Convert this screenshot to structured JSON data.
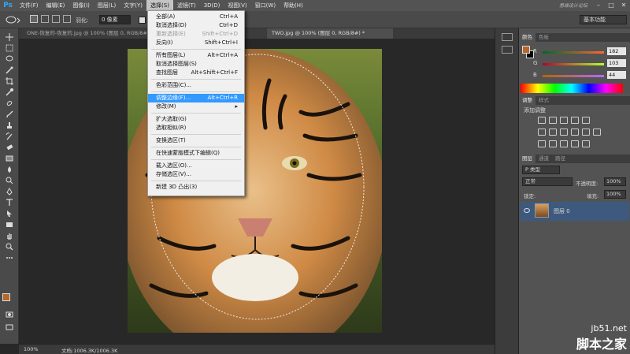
{
  "app": {
    "logo": "Ps"
  },
  "menubar": {
    "items": [
      "文件(F)",
      "编辑(E)",
      "图像(I)",
      "图层(L)",
      "文字(Y)",
      "选择(S)",
      "滤镜(T)",
      "3D(D)",
      "视图(V)",
      "窗口(W)",
      "帮助(H)"
    ],
    "active_index": 5,
    "user_text": "思缘设计论坛"
  },
  "options": {
    "feather_label": "羽化:",
    "feather_value": "0 像素",
    "workspace": "基本功能"
  },
  "tabs": [
    {
      "label": "ONE-恢复的-恢复的.jpg @ 100% (图层 0, RGB/8#) *"
    },
    {
      "label": "TWO.jpg @ 100% (图层 0, RGB/8#) *"
    }
  ],
  "select_menu": {
    "items": [
      {
        "label": "全部(A)",
        "shortcut": "Ctrl+A",
        "disabled": false
      },
      {
        "label": "取消选择(D)",
        "shortcut": "Ctrl+D",
        "disabled": false
      },
      {
        "label": "重新选择(E)",
        "shortcut": "Shift+Ctrl+D",
        "disabled": true
      },
      {
        "label": "反向(I)",
        "shortcut": "Shift+Ctrl+I",
        "disabled": false
      },
      {
        "label": "所有图层(L)",
        "shortcut": "Alt+Ctrl+A",
        "disabled": false
      },
      {
        "label": "取消选择图层(S)",
        "shortcut": "",
        "disabled": false
      },
      {
        "label": "查找图层",
        "shortcut": "Alt+Shift+Ctrl+F",
        "disabled": false
      },
      {
        "label": "色彩范围(C)...",
        "shortcut": "",
        "disabled": false
      },
      {
        "label": "调整边缘(F)...",
        "shortcut": "Alt+Ctrl+R",
        "disabled": false,
        "highlighted": true
      },
      {
        "label": "修改(M)",
        "shortcut": "▸",
        "disabled": false
      },
      {
        "label": "扩大选取(G)",
        "shortcut": "",
        "disabled": false
      },
      {
        "label": "选取相似(R)",
        "shortcut": "",
        "disabled": false
      },
      {
        "label": "变换选区(T)",
        "shortcut": "",
        "disabled": false
      },
      {
        "label": "在快速蒙版模式下编辑(Q)",
        "shortcut": "",
        "disabled": false
      },
      {
        "label": "载入选区(O)...",
        "shortcut": "",
        "disabled": false
      },
      {
        "label": "存储选区(V)...",
        "shortcut": "",
        "disabled": false
      },
      {
        "label": "新建 3D 凸出(3)",
        "shortcut": "",
        "disabled": false
      }
    ]
  },
  "status": {
    "zoom": "100%",
    "doc": "文档:1006.3K/1006.3K"
  },
  "color_panel": {
    "tabs": [
      "颜色",
      "色板"
    ],
    "r_label": "R",
    "r_value": "182",
    "g_label": "G",
    "g_value": "103",
    "b_label": "B",
    "b_value": "44",
    "foreground": "#b6672c"
  },
  "adjust_panel": {
    "tabs": [
      "调整",
      "样式"
    ],
    "subtitle": "添加调整"
  },
  "layers_panel": {
    "tabs": [
      "图层",
      "通道",
      "路径"
    ],
    "kind_label": "P 类型",
    "blend_mode": "正常",
    "opacity_label": "不透明度:",
    "opacity_value": "100%",
    "lock_label": "锁定:",
    "fill_label": "填充:",
    "fill_value": "100%",
    "layer_name": "图层 0"
  },
  "watermark": {
    "site": "jb51.net",
    "name": "脚本之家"
  }
}
